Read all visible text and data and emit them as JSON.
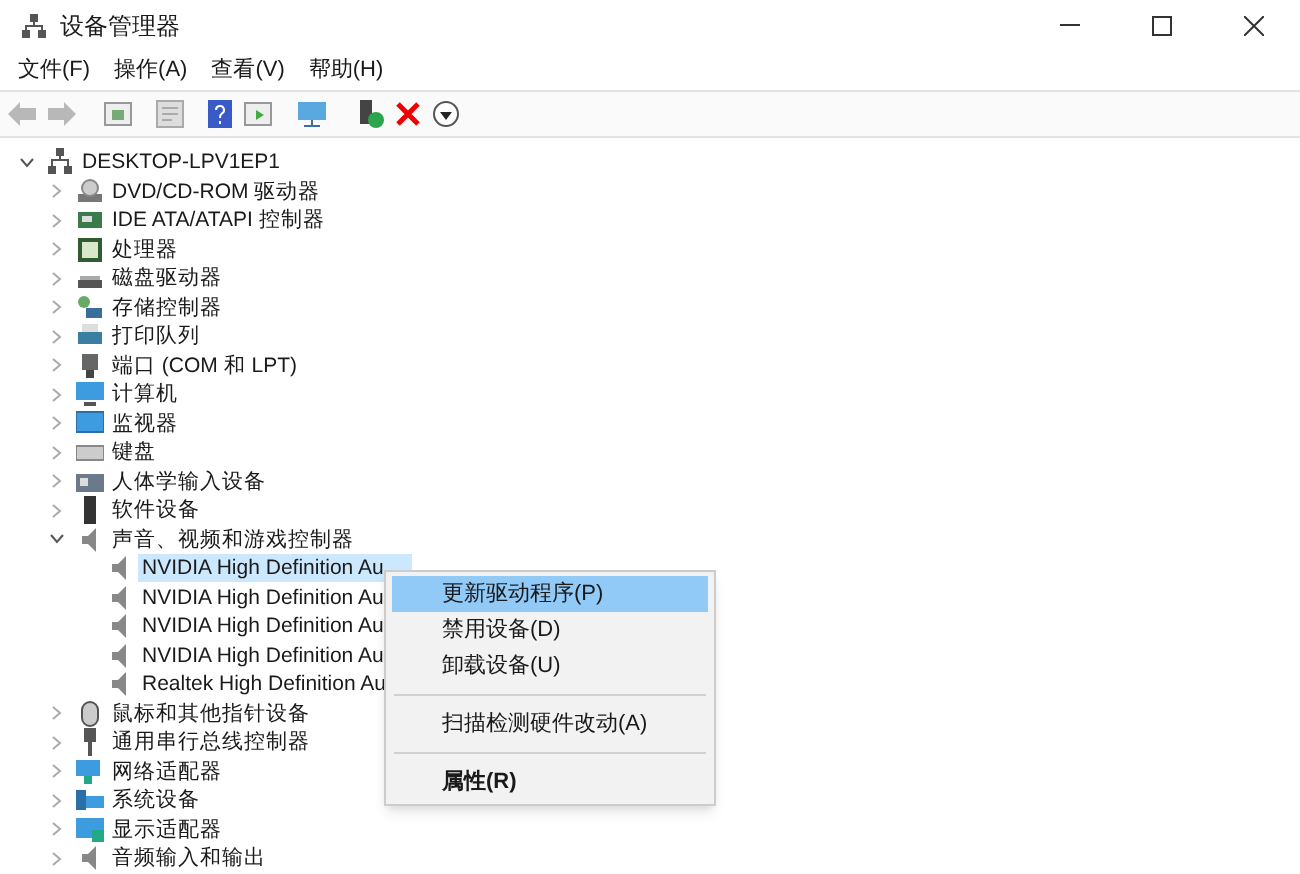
{
  "window": {
    "title": "设备管理器"
  },
  "menu_bar": [
    "文件(F)",
    "操作(A)",
    "查看(V)",
    "帮助(H)"
  ],
  "tree": {
    "label": "DESKTOP-LPV1EP1",
    "expanded": true,
    "selected": false,
    "children": [
      {
        "label": "DVD/CD-ROM 驱动器",
        "expanded": false,
        "selected": false
      },
      {
        "label": "IDE ATA/ATAPI 控制器",
        "expanded": false,
        "selected": false
      },
      {
        "label": "处理器",
        "expanded": false,
        "selected": false
      },
      {
        "label": "磁盘驱动器",
        "expanded": false,
        "selected": false
      },
      {
        "label": "存储控制器",
        "expanded": false,
        "selected": false
      },
      {
        "label": "打印队列",
        "expanded": false,
        "selected": false
      },
      {
        "label": "端口 (COM 和 LPT)",
        "expanded": false,
        "selected": false
      },
      {
        "label": "计算机",
        "expanded": false,
        "selected": false
      },
      {
        "label": "监视器",
        "expanded": false,
        "selected": false
      },
      {
        "label": "键盘",
        "expanded": false,
        "selected": false
      },
      {
        "label": "人体学输入设备",
        "expanded": false,
        "selected": false
      },
      {
        "label": "软件设备",
        "expanded": false,
        "selected": false
      },
      {
        "label": "声音、视频和游戏控制器",
        "expanded": true,
        "selected": false,
        "children": [
          {
            "label": "NVIDIA High Definition Au",
            "selected": true
          },
          {
            "label": "NVIDIA High Definition Au",
            "selected": false
          },
          {
            "label": "NVIDIA High Definition Au",
            "selected": false
          },
          {
            "label": "NVIDIA High Definition Au",
            "selected": false
          },
          {
            "label": "Realtek High Definition Au",
            "selected": false
          }
        ]
      },
      {
        "label": "鼠标和其他指针设备",
        "expanded": false,
        "selected": false
      },
      {
        "label": "通用串行总线控制器",
        "expanded": false,
        "selected": false
      },
      {
        "label": "网络适配器",
        "expanded": false,
        "selected": false
      },
      {
        "label": "系统设备",
        "expanded": false,
        "selected": false
      },
      {
        "label": "显示适配器",
        "expanded": false,
        "selected": false
      },
      {
        "label": "音频输入和输出",
        "expanded": false,
        "selected": false
      }
    ]
  },
  "context_menu": [
    {
      "kind": "item",
      "label": "更新驱动程序(P)",
      "selected": true,
      "default": false
    },
    {
      "kind": "item",
      "label": "禁用设备(D)",
      "selected": false,
      "default": false
    },
    {
      "kind": "item",
      "label": "卸载设备(U)",
      "selected": false,
      "default": false
    },
    {
      "kind": "separator"
    },
    {
      "kind": "item",
      "label": "扫描检测硬件改动(A)",
      "selected": false,
      "default": false
    },
    {
      "kind": "separator"
    },
    {
      "kind": "item",
      "label": "属性(R)",
      "selected": false,
      "default": true
    }
  ]
}
